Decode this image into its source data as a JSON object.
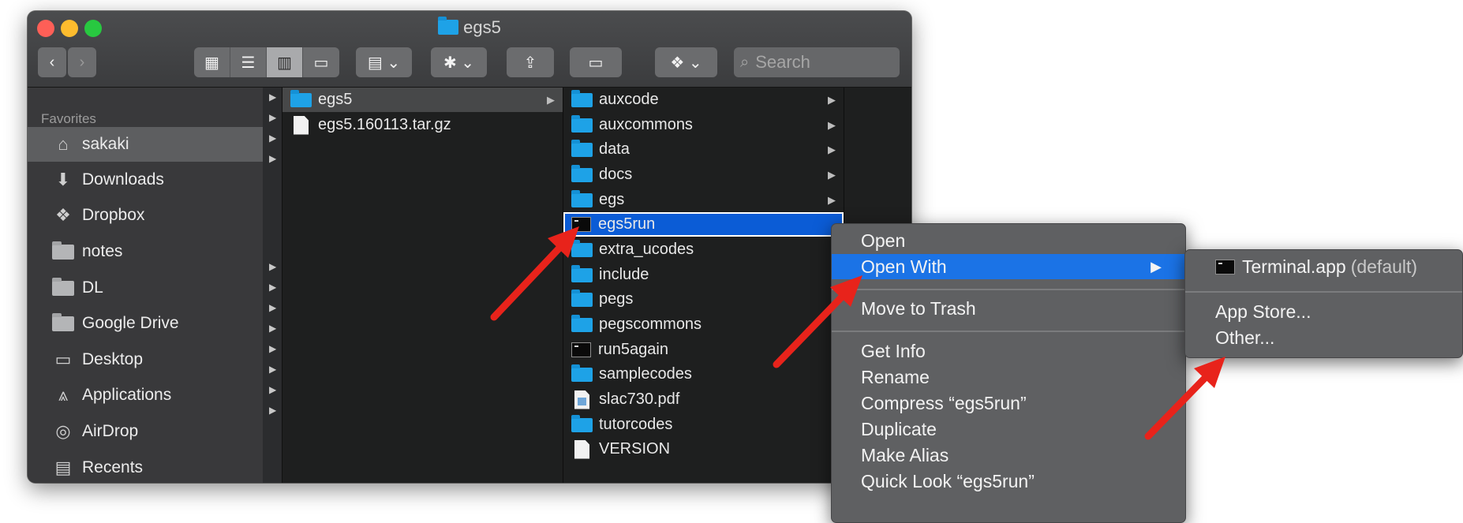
{
  "window": {
    "title": "egs5"
  },
  "toolbar": {
    "back": "‹",
    "forward": "›",
    "view_buttons": [
      "icon-view",
      "list-view",
      "column-view",
      "gallery-view"
    ],
    "search_placeholder": "Search"
  },
  "sidebar": {
    "heading": "Favorites",
    "items": [
      {
        "label": "sakaki",
        "icon": "home-icon",
        "selected": true
      },
      {
        "label": "Downloads",
        "icon": "downloads-icon"
      },
      {
        "label": "Dropbox",
        "icon": "dropbox-icon"
      },
      {
        "label": "notes",
        "icon": "folder-icon"
      },
      {
        "label": "DL",
        "icon": "folder-icon"
      },
      {
        "label": "Google Drive",
        "icon": "folder-icon"
      },
      {
        "label": "Desktop",
        "icon": "desktop-icon"
      },
      {
        "label": "Applications",
        "icon": "applications-icon"
      },
      {
        "label": "AirDrop",
        "icon": "airdrop-icon"
      },
      {
        "label": "Recents",
        "icon": "recents-icon"
      }
    ]
  },
  "column1": [
    {
      "name": "egs5",
      "type": "folder"
    },
    {
      "name": "egs5.160113.tar.gz",
      "type": "archive"
    }
  ],
  "column2": [
    {
      "name": "auxcode",
      "type": "folder"
    },
    {
      "name": "auxcommons",
      "type": "folder"
    },
    {
      "name": "data",
      "type": "folder"
    },
    {
      "name": "docs",
      "type": "folder"
    },
    {
      "name": "egs",
      "type": "folder"
    },
    {
      "name": "egs5run",
      "type": "executable",
      "selected": true
    },
    {
      "name": "extra_ucodes",
      "type": "folder"
    },
    {
      "name": "include",
      "type": "folder"
    },
    {
      "name": "pegs",
      "type": "folder"
    },
    {
      "name": "pegscommons",
      "type": "folder"
    },
    {
      "name": "run5again",
      "type": "executable"
    },
    {
      "name": "samplecodes",
      "type": "folder"
    },
    {
      "name": "slac730.pdf",
      "type": "pdf"
    },
    {
      "name": "tutorcodes",
      "type": "folder"
    },
    {
      "name": "VERSION",
      "type": "document"
    }
  ],
  "context_menu": {
    "items": [
      "Open",
      "Open With",
      "Move to Trash",
      "Get Info",
      "Rename",
      "Compress “egs5run”",
      "Duplicate",
      "Make Alias",
      "Quick Look “egs5run”"
    ],
    "highlighted": "Open With"
  },
  "submenu": {
    "default_app": "Terminal.app",
    "default_suffix": "(default)",
    "items": [
      "App Store...",
      "Other..."
    ]
  },
  "colors": {
    "accent": "#1b73e6",
    "selection": "#0b5cd6",
    "folder": "#1ea2e7",
    "annotation_arrow": "#e8231b"
  }
}
